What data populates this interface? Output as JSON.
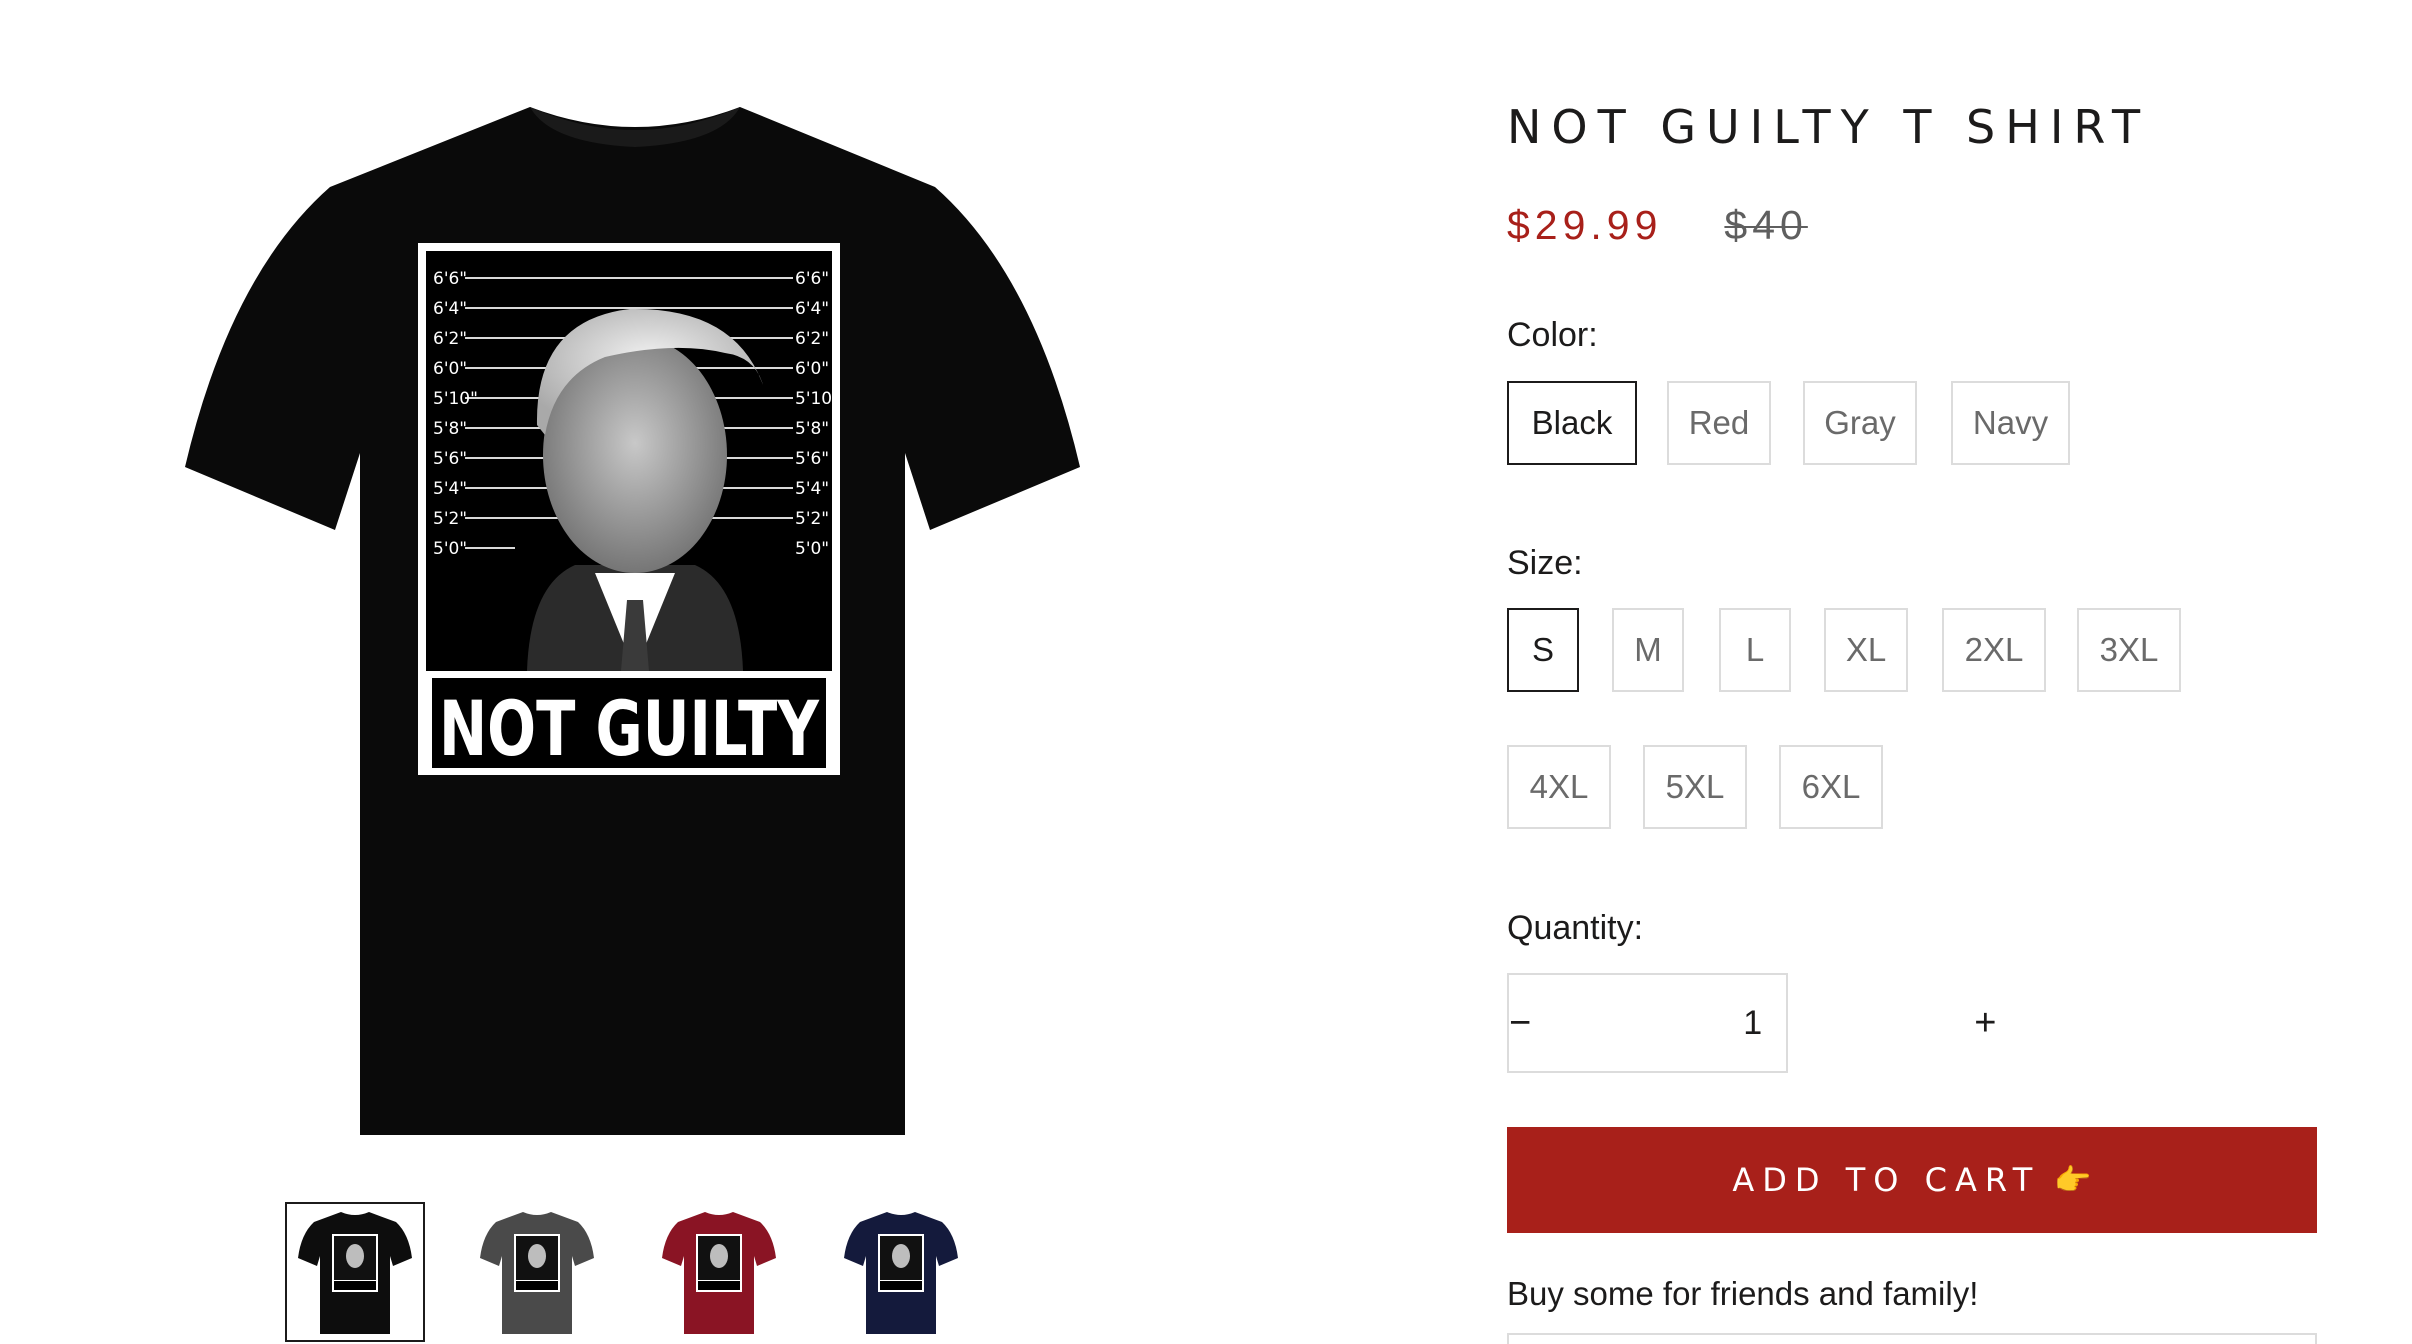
{
  "product": {
    "title": "NOT GUILTY T SHIRT",
    "sale_price": "$29.99",
    "compare_price": "$40",
    "image_text": "NOT GUILTY",
    "height_marks": [
      "6'6\"",
      "6'4\"",
      "6'2\"",
      "6'0\"",
      "5'10\"",
      "5'8\"",
      "5'6\"",
      "5'4\"",
      "5'2\"",
      "5'0\""
    ]
  },
  "color_option": {
    "label": "Color:",
    "values": [
      "Black",
      "Red",
      "Gray",
      "Navy"
    ],
    "selected": "Black"
  },
  "size_option": {
    "label": "Size:",
    "values": [
      "S",
      "M",
      "L",
      "XL",
      "2XL",
      "3XL",
      "4XL",
      "5XL",
      "6XL"
    ],
    "selected": "S"
  },
  "quantity": {
    "label": "Quantity:",
    "value": "1",
    "minus_icon": "minus-icon",
    "plus_icon": "plus-icon"
  },
  "cart": {
    "add_label": "ADD TO CART",
    "icon": "pointing-hand-icon",
    "icon_glyph": "👉"
  },
  "upsell": {
    "text": "Buy some for friends and family!"
  },
  "thumbnails": [
    {
      "color": "#0d0d0d",
      "active": true
    },
    {
      "color": "#4a4a4a",
      "active": false
    },
    {
      "color": "#8a1424",
      "active": false
    },
    {
      "color": "#141a3c",
      "active": false
    }
  ],
  "colors": {
    "accent": "#a8201a",
    "text": "#1c1b1b",
    "border": "#dcdcdc"
  }
}
